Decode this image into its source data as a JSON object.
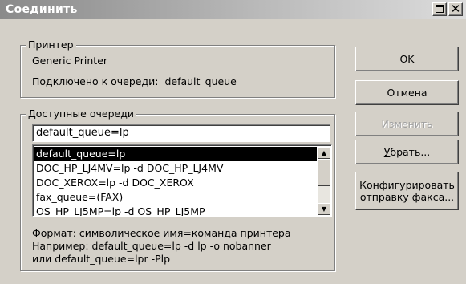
{
  "window": {
    "title": "Соединить"
  },
  "printer": {
    "legend": "Принтер",
    "name": "Generic Printer",
    "connected_label": "Подключено к очереди:",
    "connected_queue": "default_queue"
  },
  "queues": {
    "legend": "Доступные очереди",
    "input_value": "default_queue=lp",
    "items": [
      "default_queue=lp",
      "DOC_HP_LJ4MV=lp -d DOC_HP_LJ4MV",
      "DOC_XEROX=lp -d DOC_XEROX",
      "fax_queue=(FAX)",
      "OS_HP_LJ5MP=lp -d OS_HP_LJ5MP"
    ],
    "selected_index": 0,
    "help_lines": [
      "Формат: символическое имя=команда принтера",
      "Например: default_queue=lp -d lp -o nobanner",
      "или default_queue=lpr -Plp"
    ]
  },
  "buttons": {
    "ok": "OK",
    "cancel": "Отмена",
    "change": "Изменить",
    "remove_mnemonic": "У",
    "remove_rest": "брать...",
    "configure_line1": "Конфигурировать",
    "configure_line2": "отправку факса..."
  },
  "icons": {
    "maximize": "maximize-icon",
    "close": "close-icon",
    "scroll_up": "arrow-up-icon",
    "scroll_down": "arrow-down-icon"
  },
  "colors": {
    "window_bg": "#d4d0c8",
    "selection_bg": "#000000",
    "selection_fg": "#ffffff"
  }
}
